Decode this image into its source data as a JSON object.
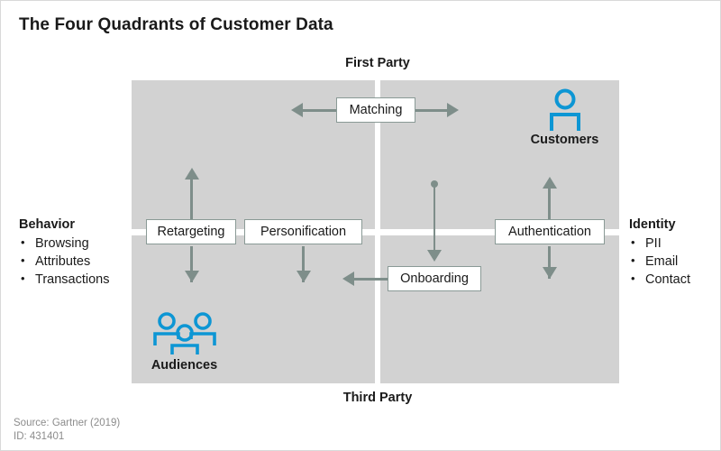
{
  "page": {
    "title": "The Four Quadrants of Customer Data"
  },
  "axes": {
    "top_label": "First Party",
    "bottom_label": "Third Party"
  },
  "left_panel": {
    "heading": "Behavior",
    "bullet_glyph": "•",
    "items": [
      "Browsing",
      "Attributes",
      "Transactions"
    ]
  },
  "right_panel": {
    "heading": "Identity",
    "bullet_glyph": "•",
    "items": [
      "PII",
      "Email",
      "Contact"
    ]
  },
  "nodes": [
    {
      "id": "matching",
      "label": "Matching"
    },
    {
      "id": "retargeting",
      "label": "Retargeting"
    },
    {
      "id": "personification",
      "label": "Personification"
    },
    {
      "id": "authentication",
      "label": "Authentication"
    },
    {
      "id": "onboarding",
      "label": "Onboarding"
    }
  ],
  "personas": [
    {
      "id": "customers",
      "label": "Customers",
      "icon": "single-person-icon"
    },
    {
      "id": "audiences",
      "label": "Audiences",
      "icon": "group-people-icon"
    }
  ],
  "footer": {
    "source": "Source: Gartner (2019)",
    "id": "ID: 431401"
  },
  "colors": {
    "quadrant_fill": "#d2d2d2",
    "divider": "#ffffff",
    "connector": "#7e8e8a",
    "persona_accent": "#0d96d4",
    "text": "#1a1a1a",
    "footer_text": "#8c8c8c"
  }
}
